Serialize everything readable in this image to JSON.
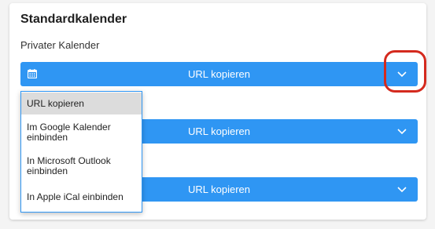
{
  "card": {
    "title": "Standardkalender"
  },
  "sections": [
    {
      "label": "Privater Kalender",
      "button_label": "URL kopieren"
    },
    {
      "label": "",
      "button_label": "URL kopieren"
    },
    {
      "label": "",
      "button_label": "URL kopieren"
    }
  ],
  "dropdown": {
    "items": [
      {
        "label": "URL kopieren",
        "selected": true
      },
      {
        "label": "Im Google Kalender einbinden",
        "selected": false
      },
      {
        "label": "In Microsoft Outlook einbinden",
        "selected": false
      },
      {
        "label": "In Apple iCal einbinden",
        "selected": false
      }
    ]
  },
  "icons": {
    "calendar": "calendar-icon",
    "toggle": "chevron-down-icon"
  },
  "colors": {
    "button_bg": "#2f96f3",
    "highlight_ring": "#d42a1e",
    "menu_border": "#2f96f3",
    "selected_item_bg": "#dcdcdc"
  }
}
